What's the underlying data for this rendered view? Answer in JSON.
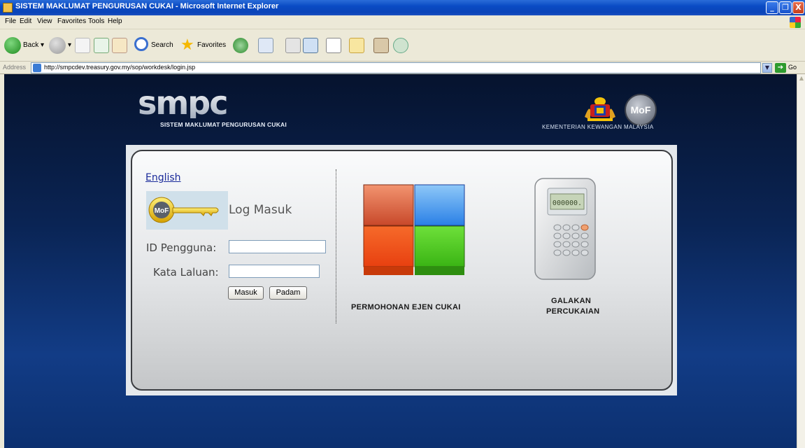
{
  "window": {
    "title": "SISTEM MAKLUMAT PENGURUSAN CUKAI - Microsoft Internet Explorer",
    "minimize_glyph": "_",
    "restore_glyph": "❐",
    "close_glyph": "X"
  },
  "menu": {
    "items": [
      "File",
      "Edit",
      "View",
      "Favorites",
      "Tools",
      "Help"
    ]
  },
  "toolbar": {
    "back_label": "Back",
    "search_label": "Search",
    "favorites_label": "Favorites"
  },
  "address": {
    "label": "Address",
    "url": "http://smpcdev.treasury.gov.my/sop/workdesk/login.jsp",
    "go_label": "Go"
  },
  "header": {
    "logo_text": "smpc",
    "subtitle": "SISTEM MAKLUMAT PENGURUSAN CUKAI",
    "mof_text": "MoF",
    "ministry": "KEMENTERIAN KEWANGAN MALAYSIA"
  },
  "login": {
    "language_link": "English",
    "title": "Log Masuk",
    "user_id_label": "ID Pengguna:",
    "user_id_value": "",
    "password_label": "Kata Laluan:",
    "password_value": "",
    "submit_label": "Masuk",
    "clear_label": "Padam"
  },
  "modules": {
    "agent_application": "PERMOHONAN EJEN CUKAI",
    "tax_incentive_line1": "GALAKAN",
    "tax_incentive_line2": "PERCUKAIAN",
    "calculator_display": "000000."
  },
  "colors": {
    "titlebar": "#0a4bc4",
    "chrome": "#ece9d8",
    "page_bg": "#0a2454",
    "link": "#1a2a9a"
  }
}
